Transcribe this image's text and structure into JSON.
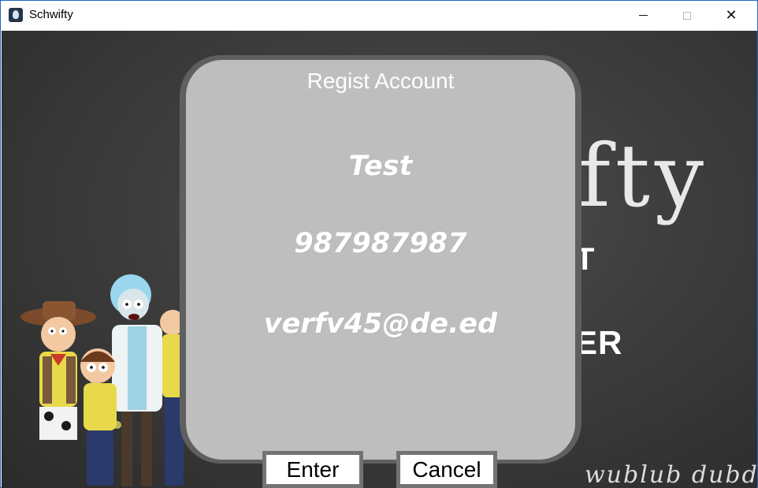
{
  "window": {
    "title": "Schwifty",
    "icon": "app-icon",
    "controls": [
      "minimize-icon",
      "maximize-icon",
      "close-icon"
    ]
  },
  "background": {
    "title_fragment": "fty",
    "line1_fragment": "T",
    "line2_fragment": "ER",
    "footer_text": "wublub dubda"
  },
  "dialog": {
    "title": "Regist Account",
    "fields": {
      "name": "Test",
      "phone": "987987987",
      "email": "verfv45@de.ed"
    },
    "buttons": {
      "enter": "Enter",
      "cancel": "Cancel"
    }
  },
  "colors": {
    "window_border": "#1f66c4",
    "dialog_frame": "#5f5f5f",
    "dialog_fill": "#bebebe",
    "button_border": "#737373"
  }
}
